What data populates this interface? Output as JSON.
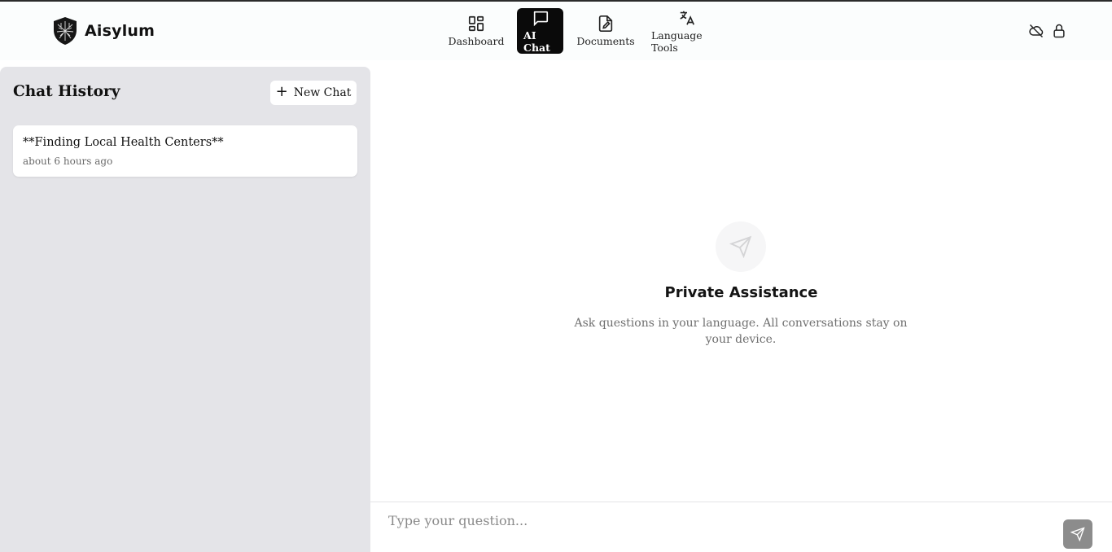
{
  "app": {
    "name": "Aisylum"
  },
  "nav": {
    "items": [
      {
        "label": "Dashboard",
        "icon": "dashboard-grid-icon",
        "active": false
      },
      {
        "label": "AI Chat",
        "icon": "chat-bubble-icon",
        "active": true
      },
      {
        "label": "Documents",
        "icon": "document-edit-icon",
        "active": false
      },
      {
        "label": "Language Tools",
        "icon": "translate-icon",
        "active": false
      }
    ]
  },
  "header_icons": [
    "cloud-off-icon",
    "lock-icon"
  ],
  "sidebar": {
    "title": "Chat History",
    "new_chat_label": "New Chat",
    "history": [
      {
        "title": "**Finding Local Health Centers**",
        "time": "about 6 hours ago"
      }
    ]
  },
  "main": {
    "empty_title": "Private Assistance",
    "empty_subtitle": "Ask questions in your language. All conversations stay on your device."
  },
  "composer": {
    "placeholder": "Type your question...",
    "send_icon": "send-icon"
  },
  "colors": {
    "active_nav_bg": "#0a0a0a",
    "sidebar_bg": "#e4e4e8",
    "send_button_bg": "#8c8c8c"
  }
}
